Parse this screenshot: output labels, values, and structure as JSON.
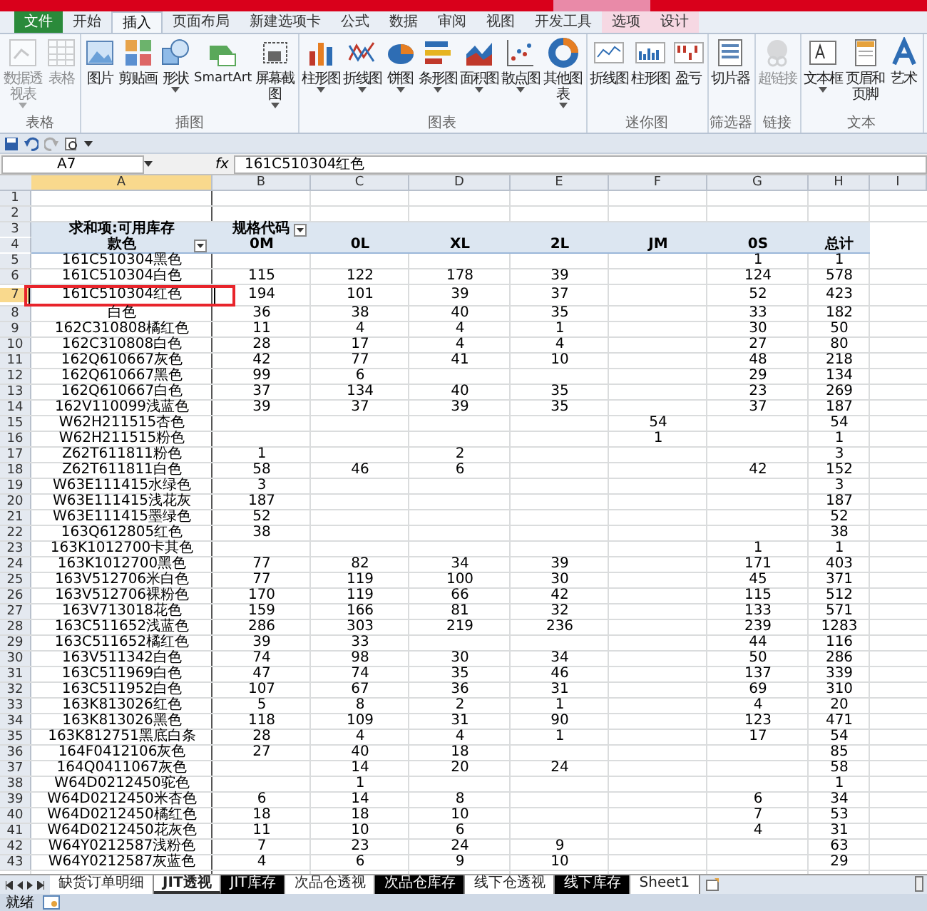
{
  "ribbon_tabs": [
    {
      "label": "文件",
      "kind": "file",
      "selected": false
    },
    {
      "label": "开始",
      "kind": "normal",
      "selected": false
    },
    {
      "label": "插入",
      "kind": "normal",
      "selected": true
    },
    {
      "label": "页面布局",
      "kind": "normal",
      "selected": false
    },
    {
      "label": "新建选项卡",
      "kind": "normal",
      "selected": false
    },
    {
      "label": "公式",
      "kind": "normal",
      "selected": false
    },
    {
      "label": "数据",
      "kind": "normal",
      "selected": false
    },
    {
      "label": "审阅",
      "kind": "normal",
      "selected": false
    },
    {
      "label": "视图",
      "kind": "normal",
      "selected": false
    },
    {
      "label": "开发工具",
      "kind": "normal",
      "selected": false
    },
    {
      "label": "选项",
      "kind": "contextual",
      "selected": false
    },
    {
      "label": "设计",
      "kind": "contextual",
      "selected": false
    }
  ],
  "ribbon_groups": [
    {
      "label": "表格",
      "items": [
        {
          "label": "数据透视表",
          "dropdown": true,
          "disabled": true
        },
        {
          "label": "表格",
          "dropdown": false,
          "disabled": true
        }
      ]
    },
    {
      "label": "插图",
      "items": [
        {
          "label": "图片",
          "dropdown": false,
          "disabled": false
        },
        {
          "label": "剪贴画",
          "dropdown": false,
          "disabled": false
        },
        {
          "label": "形状",
          "dropdown": true,
          "disabled": false
        },
        {
          "label": "SmartArt",
          "dropdown": false,
          "disabled": false
        },
        {
          "label": "屏幕截图",
          "dropdown": true,
          "disabled": false
        }
      ]
    },
    {
      "label": "图表",
      "items": [
        {
          "label": "柱形图",
          "dropdown": true,
          "disabled": false
        },
        {
          "label": "折线图",
          "dropdown": true,
          "disabled": false
        },
        {
          "label": "饼图",
          "dropdown": true,
          "disabled": false
        },
        {
          "label": "条形图",
          "dropdown": true,
          "disabled": false
        },
        {
          "label": "面积图",
          "dropdown": true,
          "disabled": false
        },
        {
          "label": "散点图",
          "dropdown": true,
          "disabled": false
        },
        {
          "label": "其他图表",
          "dropdown": true,
          "disabled": false
        }
      ]
    },
    {
      "label": "迷你图",
      "items": [
        {
          "label": "折线图",
          "dropdown": false,
          "disabled": false
        },
        {
          "label": "柱形图",
          "dropdown": false,
          "disabled": false
        },
        {
          "label": "盈亏",
          "dropdown": false,
          "disabled": false
        }
      ]
    },
    {
      "label": "筛选器",
      "items": [
        {
          "label": "切片器",
          "dropdown": false,
          "disabled": false
        }
      ]
    },
    {
      "label": "链接",
      "items": [
        {
          "label": "超链接",
          "dropdown": false,
          "disabled": true
        }
      ]
    },
    {
      "label": "文本",
      "items": [
        {
          "label": "文本框",
          "dropdown": true,
          "disabled": false
        },
        {
          "label": "页眉和页脚",
          "dropdown": false,
          "disabled": false
        },
        {
          "label": "艺术",
          "dropdown": false,
          "disabled": false
        }
      ]
    }
  ],
  "formula_bar": {
    "name_box": "A7",
    "fx": "fx",
    "formula": "161C510304红色"
  },
  "column_headers": [
    "A",
    "B",
    "C",
    "D",
    "E",
    "F",
    "G",
    "H",
    "I"
  ],
  "row_headers": [
    "1",
    "2",
    "3",
    "4",
    "5",
    "6",
    "7",
    "8",
    "9",
    "10",
    "11",
    "12",
    "13",
    "14",
    "15",
    "16",
    "17",
    "18",
    "19",
    "20",
    "21",
    "22",
    "23",
    "24",
    "25",
    "26",
    "27",
    "28",
    "29",
    "30",
    "31",
    "32",
    "33",
    "34",
    "35",
    "36",
    "37",
    "38",
    "39",
    "40",
    "41",
    "42",
    "43"
  ],
  "pivot": {
    "value_title": "求和项:可用库存",
    "column_field": "规格代码",
    "row_field": "款色",
    "columns": [
      "0M",
      "0L",
      "XL",
      "2L",
      "JM",
      "0S",
      "总计"
    ],
    "rows": [
      {
        "label": "161C510304黑色",
        "cells": {
          "g": "1",
          "h": "1"
        },
        "selected": false
      },
      {
        "label": "161C510304白色",
        "cells": {
          "b": "115",
          "c": "122",
          "d": "178",
          "e": "39",
          "g": "124",
          "h": "578"
        },
        "selected": false
      },
      {
        "label": "161C510304红色",
        "cells": {
          "b": "194",
          "c": "101",
          "d": "39",
          "e": "37",
          "g": "52",
          "h": "423"
        },
        "selected": true
      },
      {
        "label": "白色",
        "cells": {
          "b": "36",
          "c": "38",
          "d": "40",
          "e": "35",
          "g": "33",
          "h": "182"
        },
        "selected": false
      },
      {
        "label": "162C310808橘红色",
        "cells": {
          "b": "11",
          "c": "4",
          "d": "4",
          "e": "1",
          "g": "30",
          "h": "50"
        },
        "selected": false
      },
      {
        "label": "162C310808白色",
        "cells": {
          "b": "28",
          "c": "17",
          "d": "4",
          "e": "4",
          "g": "27",
          "h": "80"
        },
        "selected": false
      },
      {
        "label": "162Q610667灰色",
        "cells": {
          "b": "42",
          "c": "77",
          "d": "41",
          "e": "10",
          "g": "48",
          "h": "218"
        },
        "selected": false
      },
      {
        "label": "162Q610667黑色",
        "cells": {
          "b": "99",
          "c": "6",
          "g": "29",
          "h": "134"
        },
        "selected": false
      },
      {
        "label": "162Q610667白色",
        "cells": {
          "b": "37",
          "c": "134",
          "d": "40",
          "e": "35",
          "g": "23",
          "h": "269"
        },
        "selected": false
      },
      {
        "label": "162V110099浅蓝色",
        "cells": {
          "b": "39",
          "c": "37",
          "d": "39",
          "e": "35",
          "g": "37",
          "h": "187"
        },
        "selected": false
      },
      {
        "label": "W62H211515杏色",
        "cells": {
          "f": "54",
          "h": "54"
        },
        "selected": false
      },
      {
        "label": "W62H211515粉色",
        "cells": {
          "f": "1",
          "h": "1"
        },
        "selected": false
      },
      {
        "label": "Z62T611811粉色",
        "cells": {
          "b": "1",
          "d": "2",
          "h": "3"
        },
        "selected": false
      },
      {
        "label": "Z62T611811白色",
        "cells": {
          "b": "58",
          "c": "46",
          "d": "6",
          "g": "42",
          "h": "152"
        },
        "selected": false
      },
      {
        "label": "W63E111415水绿色",
        "cells": {
          "b": "3",
          "h": "3"
        },
        "selected": false
      },
      {
        "label": "W63E111415浅花灰",
        "cells": {
          "b": "187",
          "h": "187"
        },
        "selected": false
      },
      {
        "label": "W63E111415墨绿色",
        "cells": {
          "b": "52",
          "h": "52"
        },
        "selected": false
      },
      {
        "label": "163Q612805红色",
        "cells": {
          "b": "38",
          "h": "38"
        },
        "selected": false
      },
      {
        "label": "163K1012700卡其色",
        "cells": {
          "g": "1",
          "h": "1"
        },
        "selected": false
      },
      {
        "label": "163K1012700黑色",
        "cells": {
          "b": "77",
          "c": "82",
          "d": "34",
          "e": "39",
          "g": "171",
          "h": "403"
        },
        "selected": false
      },
      {
        "label": "163V512706米白色",
        "cells": {
          "b": "77",
          "c": "119",
          "d": "100",
          "e": "30",
          "g": "45",
          "h": "371"
        },
        "selected": false
      },
      {
        "label": "163V512706裸粉色",
        "cells": {
          "b": "170",
          "c": "119",
          "d": "66",
          "e": "42",
          "g": "115",
          "h": "512"
        },
        "selected": false
      },
      {
        "label": "163V713018花色",
        "cells": {
          "b": "159",
          "c": "166",
          "d": "81",
          "e": "32",
          "g": "133",
          "h": "571"
        },
        "selected": false
      },
      {
        "label": "163C511652浅蓝色",
        "cells": {
          "b": "286",
          "c": "303",
          "d": "219",
          "e": "236",
          "g": "239",
          "h": "1283"
        },
        "selected": false
      },
      {
        "label": "163C511652橘红色",
        "cells": {
          "b": "39",
          "c": "33",
          "g": "44",
          "h": "116"
        },
        "selected": false
      },
      {
        "label": "163V511342白色",
        "cells": {
          "b": "74",
          "c": "98",
          "d": "30",
          "e": "34",
          "g": "50",
          "h": "286"
        },
        "selected": false
      },
      {
        "label": "163C511969白色",
        "cells": {
          "b": "47",
          "c": "74",
          "d": "35",
          "e": "46",
          "g": "137",
          "h": "339"
        },
        "selected": false
      },
      {
        "label": "163C511952白色",
        "cells": {
          "b": "107",
          "c": "67",
          "d": "36",
          "e": "31",
          "g": "69",
          "h": "310"
        },
        "selected": false
      },
      {
        "label": "163K813026红色",
        "cells": {
          "b": "5",
          "c": "8",
          "d": "2",
          "e": "1",
          "g": "4",
          "h": "20"
        },
        "selected": false
      },
      {
        "label": "163K813026黑色",
        "cells": {
          "b": "118",
          "c": "109",
          "d": "31",
          "e": "90",
          "g": "123",
          "h": "471"
        },
        "selected": false
      },
      {
        "label": "163K812751黑底白条",
        "cells": {
          "b": "28",
          "c": "4",
          "d": "4",
          "e": "1",
          "g": "17",
          "h": "54"
        },
        "selected": false
      },
      {
        "label": "164F0412106灰色",
        "cells": {
          "b": "27",
          "c": "40",
          "d": "18",
          "h": "85"
        },
        "selected": false
      },
      {
        "label": "164Q0411067灰色",
        "cells": {
          "c": "14",
          "d": "20",
          "e": "24",
          "h": "58"
        },
        "selected": false
      },
      {
        "label": "W64D0212450驼色",
        "cells": {
          "c": "1",
          "h": "1"
        },
        "selected": false
      },
      {
        "label": "W64D0212450米杏色",
        "cells": {
          "b": "6",
          "c": "14",
          "d": "8",
          "g": "6",
          "h": "34"
        },
        "selected": false
      },
      {
        "label": "W64D0212450橘红色",
        "cells": {
          "b": "18",
          "c": "18",
          "d": "10",
          "g": "7",
          "h": "53"
        },
        "selected": false
      },
      {
        "label": "W64D0212450花灰色",
        "cells": {
          "b": "11",
          "c": "10",
          "d": "6",
          "g": "4",
          "h": "31"
        },
        "selected": false
      },
      {
        "label": "W64Y0212587浅粉色",
        "cells": {
          "b": "7",
          "c": "23",
          "d": "24",
          "e": "9",
          "h": "63"
        },
        "selected": false
      },
      {
        "label": "W64Y0212587灰蓝色",
        "cells": {
          "b": "4",
          "c": "6",
          "d": "9",
          "e": "10",
          "h": "29"
        },
        "selected": false
      }
    ]
  },
  "sheet_tabs": [
    {
      "label": "缺货订单明细",
      "selected": false,
      "color": "#ffffff"
    },
    {
      "label": "JIT透视",
      "selected": true,
      "color": "#ffffff"
    },
    {
      "label": "JIT库存",
      "selected": false,
      "color": "#000000"
    },
    {
      "label": "次品仓透视",
      "selected": false,
      "color": "#ffffff"
    },
    {
      "label": "次品仓库存",
      "selected": false,
      "color": "#000000"
    },
    {
      "label": "线下仓透视",
      "selected": false,
      "color": "#ffffff"
    },
    {
      "label": "线下库存",
      "selected": false,
      "color": "#000000"
    },
    {
      "label": "Sheet1",
      "selected": false,
      "color": "#ffffff"
    }
  ],
  "status_bar": {
    "text": "就绪"
  }
}
